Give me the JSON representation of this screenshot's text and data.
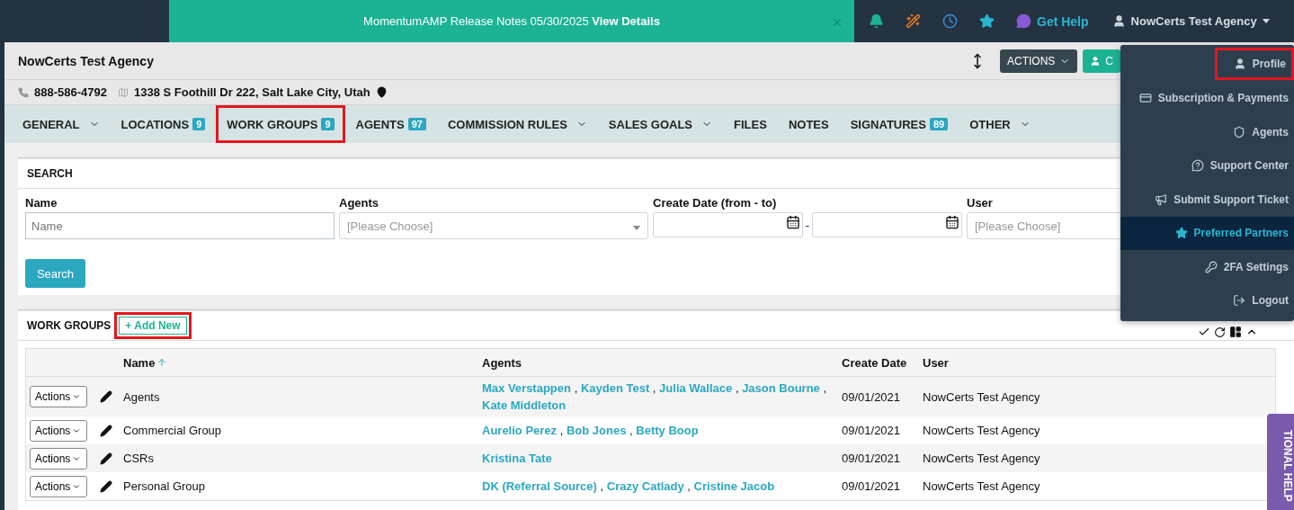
{
  "top_bar": {
    "banner": "MomentumAMP Release Notes 05/30/2025 **View Details**",
    "help": "Get Help",
    "account": "NowCerts Test Agency"
  },
  "agency": {
    "name": "NowCerts Test Agency",
    "phone": "888-586-4792",
    "address": "1338 S Foothill Dr 222, Salt Lake City, Utah"
  },
  "header_buttons": [
    {
      "kind": "dark",
      "label": "ACTIONS"
    },
    {
      "kind": "teal",
      "label": "C"
    }
  ],
  "nav_tabs": [
    {
      "label": "GENERAL",
      "dropdown": true,
      "highlighted": false
    },
    {
      "label": "LOCATIONS",
      "badge": "9",
      "dropdown": false,
      "highlighted": false
    },
    {
      "label": "WORK GROUPS",
      "badge": "9",
      "dropdown": false,
      "highlighted": true
    },
    {
      "label": "AGENTS",
      "badge": "97",
      "dropdown": false,
      "highlighted": false
    },
    {
      "label": "COMMISSION RULES",
      "dropdown": true,
      "highlighted": false
    },
    {
      "label": "SALES GOALS",
      "dropdown": true,
      "highlighted": false
    },
    {
      "label": "FILES",
      "dropdown": false,
      "highlighted": false
    },
    {
      "label": "NOTES",
      "dropdown": false,
      "highlighted": false
    },
    {
      "label": "SIGNATURES",
      "badge": "89",
      "dropdown": false,
      "highlighted": false
    },
    {
      "label": "OTHER",
      "dropdown": true,
      "highlighted": false
    }
  ],
  "search": {
    "title": "SEARCH",
    "fields": [
      {
        "kind": "text",
        "label": "Name",
        "placeholder": "Name"
      },
      {
        "kind": "select",
        "label": "Agents",
        "placeholder": "[Please Choose]"
      },
      {
        "kind": "daterange",
        "label": "Create Date (from - to)",
        "separator": "-"
      },
      {
        "kind": "select",
        "label": "User",
        "placeholder": "[Please Choose]"
      }
    ],
    "button": "Search"
  },
  "work_groups": {
    "title": "WORK GROUPS",
    "add_button": "+ Add New",
    "add_highlighted": true,
    "columns": [
      "Name",
      "Agents",
      "Create Date",
      "User"
    ],
    "separator": ",",
    "rows": [
      {
        "action": "Actions",
        "name": "Agents",
        "agents": [
          "Max Verstappen",
          "Kayden Test",
          "Julia Wallace",
          "Jason Bourne",
          "Kate Middleton"
        ],
        "date": "09/01/2021",
        "user": "NowCerts Test Agency"
      },
      {
        "action": "Actions",
        "name": "Commercial Group",
        "agents": [
          "Aurelio Perez",
          "Bob Jones",
          "Betty Boop"
        ],
        "date": "09/01/2021",
        "user": "NowCerts Test Agency"
      },
      {
        "action": "Actions",
        "name": "CSRs",
        "agents": [
          "Kristina Tate"
        ],
        "date": "09/01/2021",
        "user": "NowCerts Test Agency"
      },
      {
        "action": "Actions",
        "name": "Personal Group",
        "agents": [
          "DK (Referral Source)",
          "Crazy Catlady",
          "Cristine Jacob"
        ],
        "date": "09/01/2021",
        "user": "NowCerts Test Agency"
      }
    ]
  },
  "account_menu": [
    {
      "kind": "user",
      "label": "Profile",
      "selected": false,
      "highlighted": true
    },
    {
      "kind": "card",
      "label": "Subscription & Payments",
      "selected": false,
      "highlighted": false
    },
    {
      "kind": "shield",
      "label": "Agents",
      "selected": false,
      "highlighted": false
    },
    {
      "kind": "help",
      "label": "Support Center",
      "selected": false,
      "highlighted": false
    },
    {
      "kind": "megaphone",
      "label": "Submit Support Ticket",
      "selected": false,
      "highlighted": false
    },
    {
      "kind": "star",
      "label": "Preferred Partners",
      "selected": true,
      "highlighted": false
    },
    {
      "kind": "key",
      "label": "2FA Settings",
      "selected": false,
      "highlighted": false
    },
    {
      "kind": "logout",
      "label": "Logout",
      "selected": false,
      "highlighted": false
    }
  ],
  "side_tab": "TIONAL HELP"
}
